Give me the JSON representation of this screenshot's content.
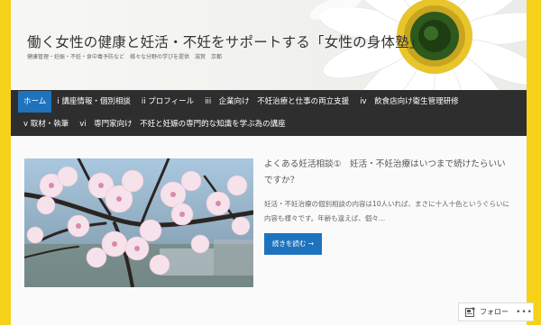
{
  "header": {
    "title": "働く女性の健康と妊活・不妊をサポートする「女性の身体塾」",
    "description": "健康管理・妊娠・不妊・食中毒予防など　様々な分野の学びを提供　滋賀　京都"
  },
  "nav": {
    "row1": [
      {
        "label": "ホーム",
        "active": true
      },
      {
        "label": "i 講座情報・個別相談"
      },
      {
        "label": "ii プロフィール"
      },
      {
        "label": "iii　企業向け　不妊治療と仕事の両立支援"
      },
      {
        "label": "iv　飲食店向け衛生管理研修"
      }
    ],
    "row2": [
      {
        "label": "v 取材・執筆"
      },
      {
        "label": "vi　専門家向け　不妊と妊娠の専門的な知識を学ぶ為の講座"
      }
    ]
  },
  "post": {
    "title": "よくある妊活相談①　妊活・不妊治療はいつまで続けたらいいですか？",
    "excerpt": "妊活・不妊治療の個別相談の内容は10人いれば、まさに十人十色というぐらいに内容も様々です。年齢も違えば、個々…",
    "more_label": "続きを読む →"
  },
  "follow": {
    "label": "フォロー",
    "more": "•••"
  },
  "colors": {
    "accent": "#1e73be",
    "nav_bg": "#2e2e2e",
    "frame": "#f6d11a"
  }
}
